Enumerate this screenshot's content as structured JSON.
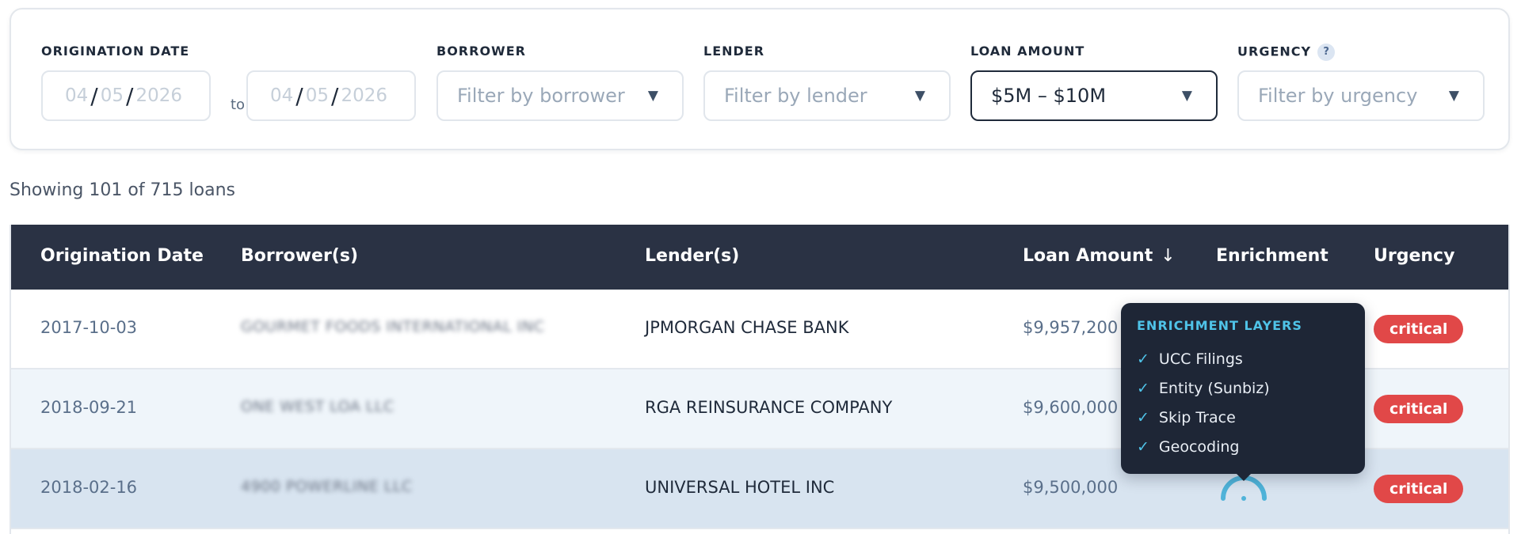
{
  "filters": {
    "origination_date": {
      "label": "ORIGINATION DATE",
      "from": {
        "month": "04",
        "day": "05",
        "year": "2026"
      },
      "to_label": "to",
      "to": {
        "month": "04",
        "day": "05",
        "year": "2026"
      }
    },
    "borrower": {
      "label": "BORROWER",
      "placeholder": "Filter by borrower"
    },
    "lender": {
      "label": "LENDER",
      "placeholder": "Filter by lender"
    },
    "loan_amount": {
      "label": "LOAN AMOUNT",
      "value": "$5M – $10M"
    },
    "urgency": {
      "label": "URGENCY",
      "help": "?",
      "placeholder": "Filter by urgency"
    },
    "caret": "▼"
  },
  "count_text": "Showing 101 of 715 loans",
  "table": {
    "columns": {
      "origination_date": "Origination Date",
      "borrowers": "Borrower(s)",
      "lenders": "Lender(s)",
      "loan_amount": "Loan Amount",
      "sort_indicator": "↓",
      "enrichment": "Enrichment",
      "urgency": "Urgency"
    },
    "rows": [
      {
        "date": "2017-10-03",
        "borrower": "GOURMET FOODS INTERNATIONAL INC",
        "lender": "JPMORGAN CHASE BANK",
        "amount": "$9,957,200",
        "urgency": "critical"
      },
      {
        "date": "2018-09-21",
        "borrower": "ONE WEST LOA LLC",
        "lender": "RGA REINSURANCE COMPANY",
        "amount": "$9,600,000",
        "urgency": "critical"
      },
      {
        "date": "2018-02-16",
        "borrower": "4900 POWERLINE LLC",
        "lender": "UNIVERSAL HOTEL INC",
        "amount": "$9,500,000",
        "urgency": "critical"
      }
    ]
  },
  "tooltip": {
    "title": "ENRICHMENT LAYERS",
    "check": "✓",
    "items": [
      "UCC Filings",
      "Entity (Sunbiz)",
      "Skip Trace",
      "Geocoding"
    ]
  },
  "colors": {
    "header_bg": "#2a3244",
    "critical": "#e14848",
    "accent_cyan": "#4fc3e8",
    "tooltip_bg": "#1e2636"
  },
  "icons": {
    "sort": "arrow-down-icon",
    "enrichment": "enrichment-gauge-icon",
    "check": "check-icon",
    "caret": "chevron-down-icon",
    "help": "help-icon"
  }
}
